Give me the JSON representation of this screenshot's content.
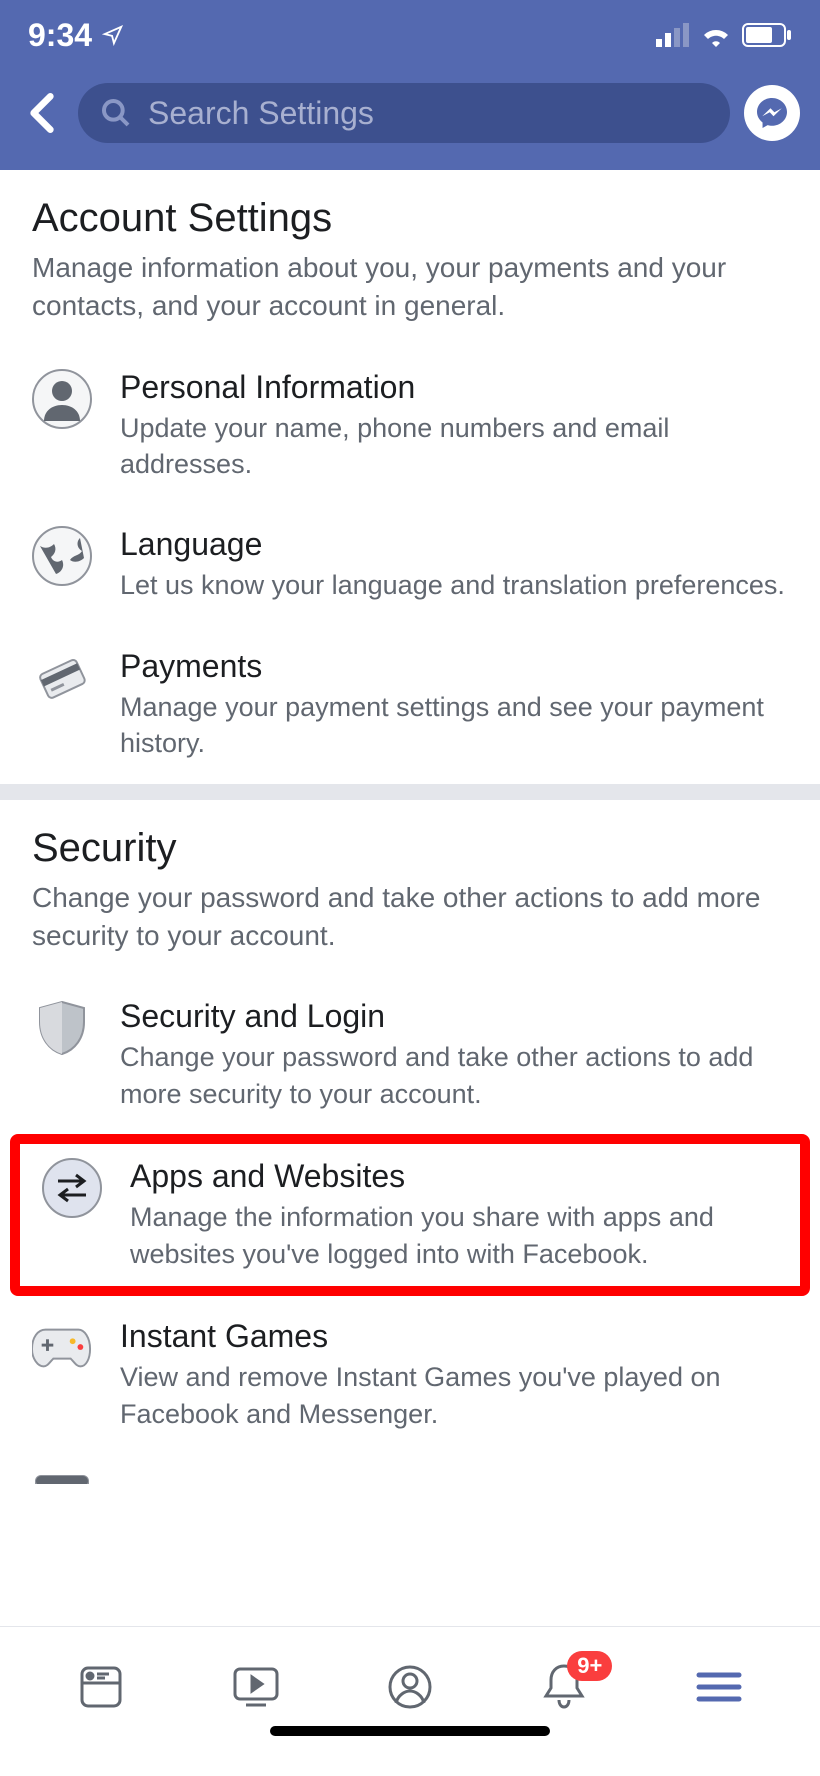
{
  "status": {
    "time": "9:34"
  },
  "header": {
    "search_placeholder": "Search Settings"
  },
  "sections": [
    {
      "title": "Account Settings",
      "subtitle": "Manage information about you, your payments and your contacts, and your account in general.",
      "items": [
        {
          "title": "Personal Information",
          "subtitle": "Update your name, phone numbers and email addresses."
        },
        {
          "title": "Language",
          "subtitle": "Let us know your language and translation preferences."
        },
        {
          "title": "Payments",
          "subtitle": "Manage your payment settings and see your payment history."
        }
      ]
    },
    {
      "title": "Security",
      "subtitle": "Change your password and take other actions to add more security to your account.",
      "items": [
        {
          "title": "Security and Login",
          "subtitle": "Change your password and take other actions to add more security to your account."
        },
        {
          "title": "Apps and Websites",
          "subtitle": "Manage the information you share with apps and websites you've logged into with Facebook."
        },
        {
          "title": "Instant Games",
          "subtitle": "View and remove Instant Games you've played on Facebook and Messenger."
        }
      ]
    }
  ],
  "bottom": {
    "badge": "9+"
  }
}
